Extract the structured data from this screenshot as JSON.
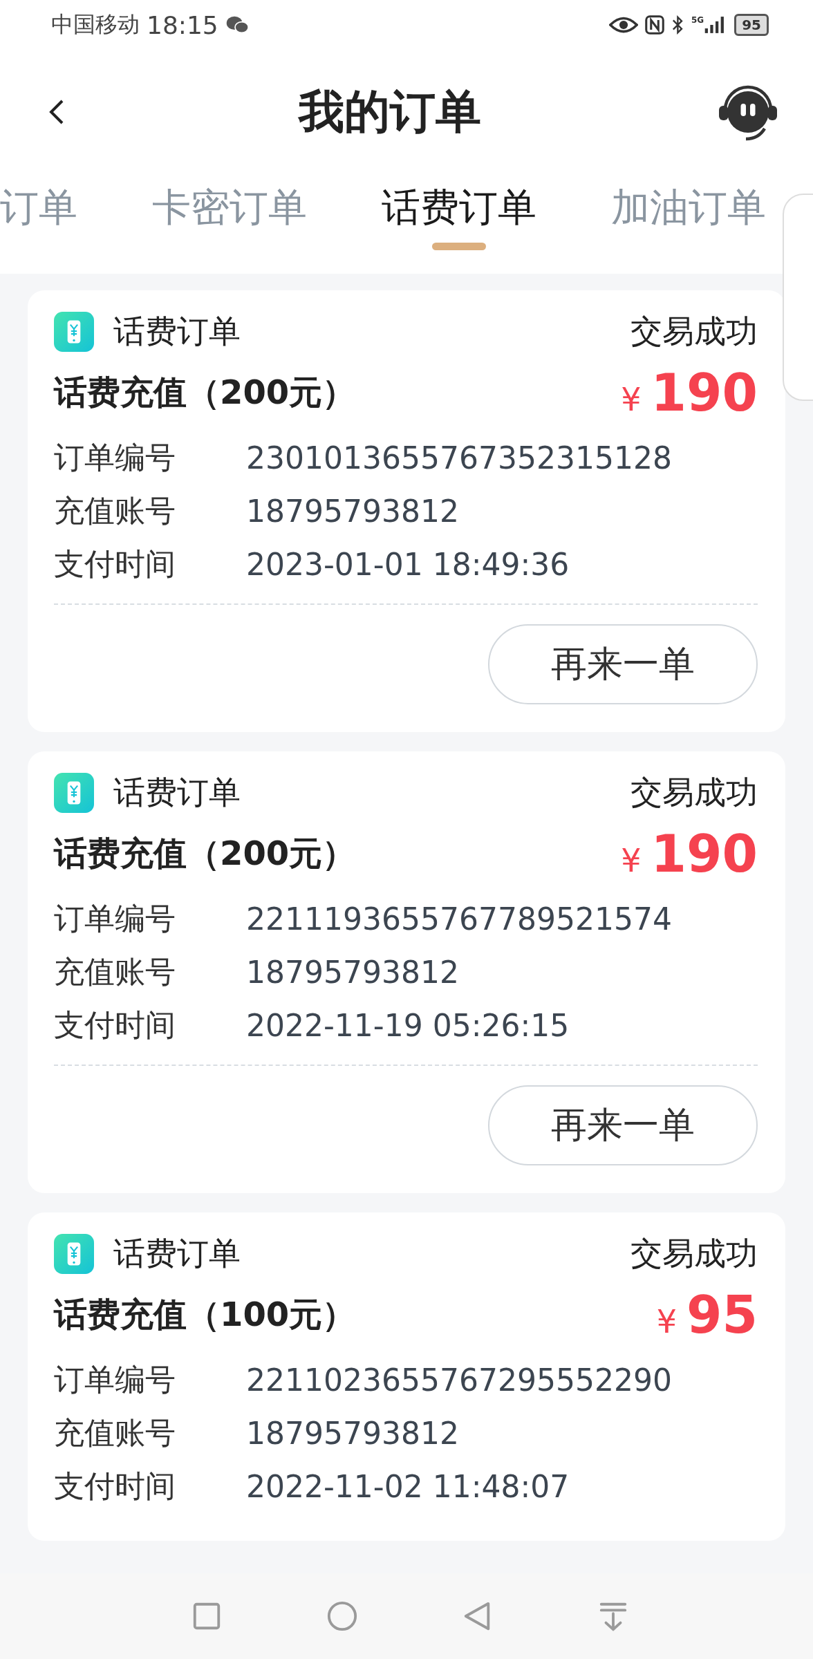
{
  "status_bar": {
    "carrier": "中国移动",
    "time": "18:15",
    "network": "5G",
    "battery": "95"
  },
  "header": {
    "title": "我的订单"
  },
  "tabs": [
    {
      "label": "订单",
      "selected": false
    },
    {
      "label": "卡密订单",
      "selected": false
    },
    {
      "label": "话费订单",
      "selected": true
    },
    {
      "label": "加油订单",
      "selected": false
    }
  ],
  "orders": [
    {
      "category": "话费订单",
      "status": "交易成功",
      "title": "话费充值（200元）",
      "currency": "¥",
      "amount": "190",
      "fields": [
        {
          "label": "订单编号",
          "value": "2301013655767352315128"
        },
        {
          "label": "充值账号",
          "value": "18795793812"
        },
        {
          "label": "支付时间",
          "value": "2023-01-01 18:49:36"
        }
      ],
      "button": "再来一单"
    },
    {
      "category": "话费订单",
      "status": "交易成功",
      "title": "话费充值（200元）",
      "currency": "¥",
      "amount": "190",
      "fields": [
        {
          "label": "订单编号",
          "value": "2211193655767789521574"
        },
        {
          "label": "充值账号",
          "value": "18795793812"
        },
        {
          "label": "支付时间",
          "value": "2022-11-19 05:26:15"
        }
      ],
      "button": "再来一单"
    },
    {
      "category": "话费订单",
      "status": "交易成功",
      "title": "话费充值（100元）",
      "currency": "¥",
      "amount": "95",
      "fields": [
        {
          "label": "订单编号",
          "value": "2211023655767295552290"
        },
        {
          "label": "充值账号",
          "value": "18795793812"
        },
        {
          "label": "支付时间",
          "value": "2022-11-02 11:48:07"
        }
      ]
    }
  ]
}
